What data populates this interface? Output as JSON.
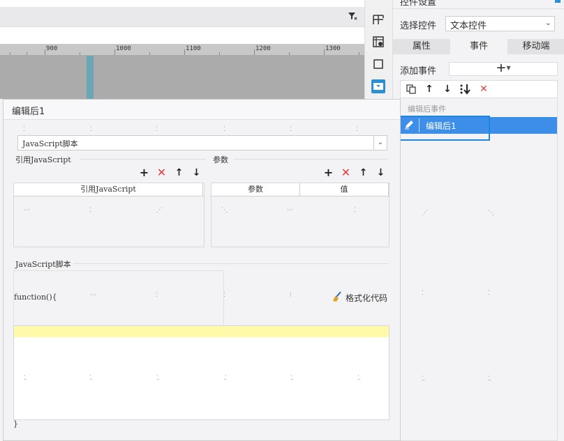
{
  "background": {
    "ruler_labels": [
      "900",
      "1000",
      "1100",
      "1200",
      "1300"
    ]
  },
  "right_panel": {
    "title": "控件设置",
    "select_label": "选择控件",
    "select_value": "文本控件",
    "tabs": [
      "属性",
      "事件",
      "移动端"
    ],
    "add_event_label": "添加事件",
    "add_event_button": "+",
    "event_group": "编辑后事件",
    "event_item": "编辑后1"
  },
  "dialog": {
    "title": "编辑后1",
    "script_type": "JavaScript脚本",
    "ref_js_label": "引用JavaScript",
    "params_label": "参数",
    "ref_table_header": "引用JavaScript",
    "params_table_headers": [
      "参数",
      "值"
    ],
    "js_script_label": "JavaScript脚本",
    "function_open": "function(){",
    "format_button": "格式化代码",
    "function_close": "}"
  },
  "colors": {
    "accent": "#3d8ee8",
    "delete_red": "#e23b3b",
    "code_highlight": "#fffaaa"
  }
}
